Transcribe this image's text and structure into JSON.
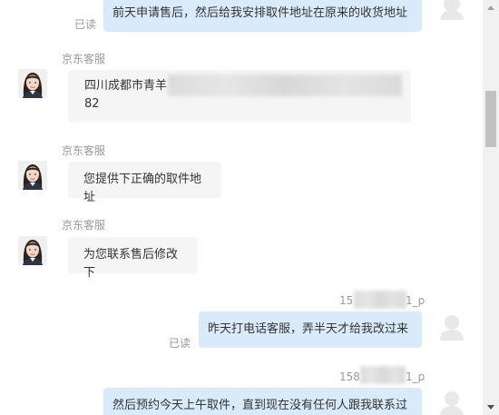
{
  "messages": [
    {
      "id": "m1",
      "direction": "out",
      "text": "前天申请售后，然后给我安排取件地址在原来的收货地址",
      "status": "已读"
    },
    {
      "id": "m2",
      "direction": "in",
      "sender": "京东客服",
      "text_line1": "四川成都市青羊",
      "text_line2": "82"
    },
    {
      "id": "m3",
      "direction": "in",
      "sender": "京东客服",
      "text": "您提供下正确的取件地址"
    },
    {
      "id": "m4",
      "direction": "in",
      "sender": "京东客服",
      "text": "为您联系售后修改下"
    },
    {
      "id": "m5",
      "direction": "out",
      "sender_prefix": "15",
      "sender_suffix": "1_p",
      "text": "昨天打电话客服，弄半天才给我改过来",
      "status": "已读"
    },
    {
      "id": "m6",
      "direction": "out",
      "sender_prefix": "158",
      "sender_suffix": "1_p",
      "text": "然后预约今天上午取件，直到现在没有任何人跟我联系过"
    }
  ],
  "icons": {
    "agent_avatar": "female-agent-avatar-icon",
    "user_avatar": "user-avatar-icon",
    "scroll_up": "triangle-up-icon",
    "scroll_down": "triangle-down-icon"
  },
  "colors": {
    "bubble_out": "#d9ebfb",
    "bubble_in": "#f5f5f5",
    "meta_text": "#999999"
  }
}
